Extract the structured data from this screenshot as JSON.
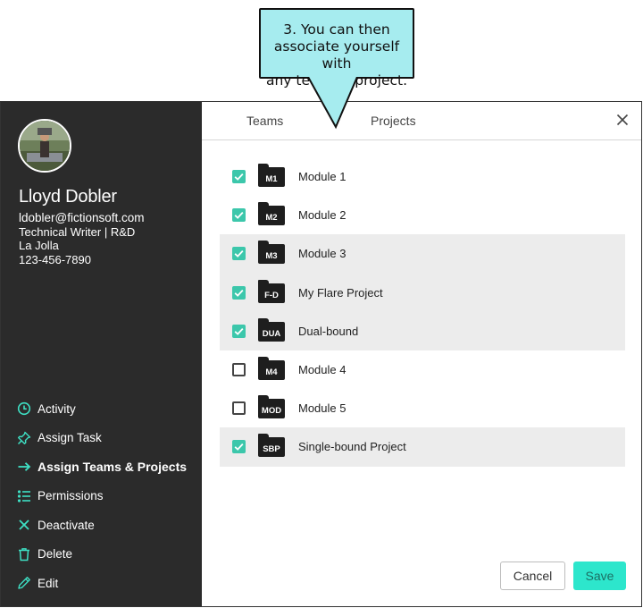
{
  "callout": {
    "text_lines": [
      "3. You can then",
      "associate yourself with",
      "any team or project."
    ]
  },
  "profile": {
    "name": "Lloyd Dobler",
    "email": "ldobler@fictionsoft.com",
    "title": "Technical Writer | R&D",
    "location": "La Jolla",
    "phone": "123-456-7890"
  },
  "menu": [
    {
      "label": "Activity",
      "icon": "clock-icon"
    },
    {
      "label": "Assign Task",
      "icon": "pin-icon"
    },
    {
      "label": "Assign Teams & Projects",
      "icon": "arrow-right-icon",
      "active": true
    },
    {
      "label": "Permissions",
      "icon": "list-icon"
    },
    {
      "label": "Deactivate",
      "icon": "x-icon"
    },
    {
      "label": "Delete",
      "icon": "trash-icon"
    },
    {
      "label": "Edit",
      "icon": "pencil-icon"
    }
  ],
  "tabs": {
    "teams": "Teams",
    "projects": "Projects"
  },
  "projects": [
    {
      "badge": "M1",
      "name": "Module 1",
      "checked": true,
      "highlighted": false
    },
    {
      "badge": "M2",
      "name": "Module 2",
      "checked": true,
      "highlighted": false
    },
    {
      "badge": "M3",
      "name": "Module 3",
      "checked": true,
      "highlighted": true
    },
    {
      "badge": "F-D",
      "name": "My Flare Project",
      "checked": true,
      "highlighted": true
    },
    {
      "badge": "DUA",
      "name": "Dual-bound",
      "checked": true,
      "highlighted": true
    },
    {
      "badge": "M4",
      "name": "Module 4",
      "checked": false,
      "highlighted": false
    },
    {
      "badge": "MOD",
      "name": "Module 5",
      "checked": false,
      "highlighted": false
    },
    {
      "badge": "SBP",
      "name": "Single-bound Project",
      "checked": true,
      "highlighted": true
    }
  ],
  "buttons": {
    "cancel": "Cancel",
    "save": "Save"
  },
  "colors": {
    "sidebar": "#2b2b2b",
    "accent": "#3cc7ab",
    "save_button": "#2de6cc",
    "callout": "#a6ecef",
    "highlight_row": "#ececec"
  }
}
